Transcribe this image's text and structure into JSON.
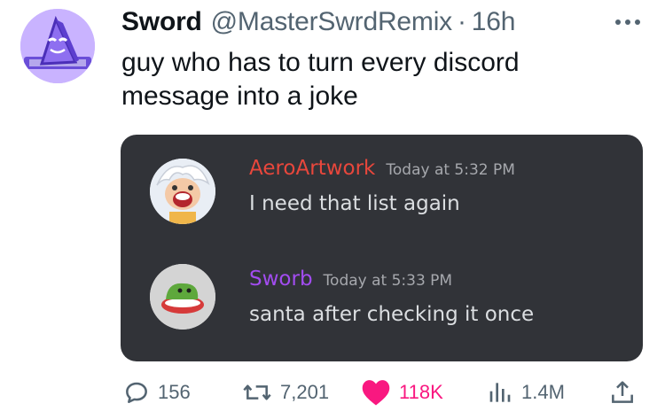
{
  "tweet": {
    "author_name": "Sword",
    "author_handle": "@MasterSwrdRemix",
    "separator": "·",
    "time": "16h",
    "text_lines": [
      "guy who has to turn every discord",
      "message into a joke"
    ]
  },
  "embedded_screenshot": {
    "messages": [
      {
        "username": "AeroArtwork",
        "username_color": "#e8473c",
        "timestamp": "Today at 5:32 PM",
        "text": "I need that list again"
      },
      {
        "username": "Sworb",
        "username_color": "#a24cf0",
        "timestamp": "Today at 5:33 PM",
        "text": "santa after checking it once"
      }
    ]
  },
  "actions": {
    "replies": "156",
    "reposts": "7,201",
    "likes": "118K",
    "views": "1.4M"
  },
  "colors": {
    "text_primary": "#0f1419",
    "text_secondary": "#536471",
    "like_pink": "#f91880",
    "discord_bg": "#313338"
  },
  "icons": [
    "more-options-icon",
    "reply-icon",
    "repost-icon",
    "like-heart-icon",
    "views-icon",
    "share-icon"
  ]
}
